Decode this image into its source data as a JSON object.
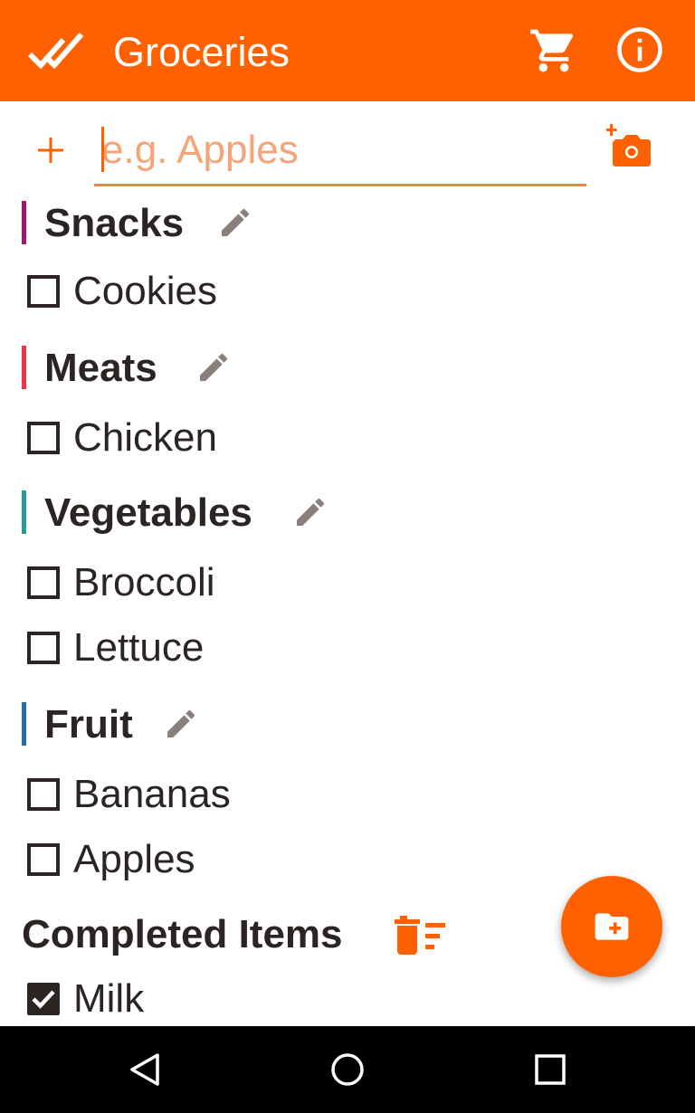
{
  "colors": {
    "accent": "#ff6000",
    "placeholder": "#f4a477",
    "edit_icon": "#8a7f7b",
    "text": "#2b2423",
    "nav_bar": "#000000"
  },
  "app_bar": {
    "title": "Groceries",
    "icons": [
      "double-check-icon",
      "cart-icon",
      "info-icon"
    ]
  },
  "add_item": {
    "placeholder": "e.g. Apples",
    "value": "",
    "icons": [
      "plus-icon",
      "add-photo-icon"
    ]
  },
  "sections": [
    {
      "name": "Snacks",
      "color": "#a0186e",
      "items": [
        {
          "label": "Cookies",
          "checked": false
        }
      ]
    },
    {
      "name": "Meats",
      "color": "#e8364a",
      "items": [
        {
          "label": "Chicken",
          "checked": false
        }
      ]
    },
    {
      "name": "Vegetables",
      "color": "#2a9a94",
      "items": [
        {
          "label": "Broccoli",
          "checked": false
        },
        {
          "label": "Lettuce",
          "checked": false
        }
      ]
    },
    {
      "name": "Fruit",
      "color": "#1f6fb0",
      "items": [
        {
          "label": "Bananas",
          "checked": false
        },
        {
          "label": "Apples",
          "checked": false
        }
      ]
    }
  ],
  "completed": {
    "title": "Completed Items",
    "items": [
      {
        "label": "Milk",
        "checked": true
      }
    ]
  },
  "fab": {
    "icon": "add-category-folder-icon"
  },
  "nav": {
    "icons": [
      "back-icon",
      "home-icon",
      "recents-icon"
    ]
  }
}
